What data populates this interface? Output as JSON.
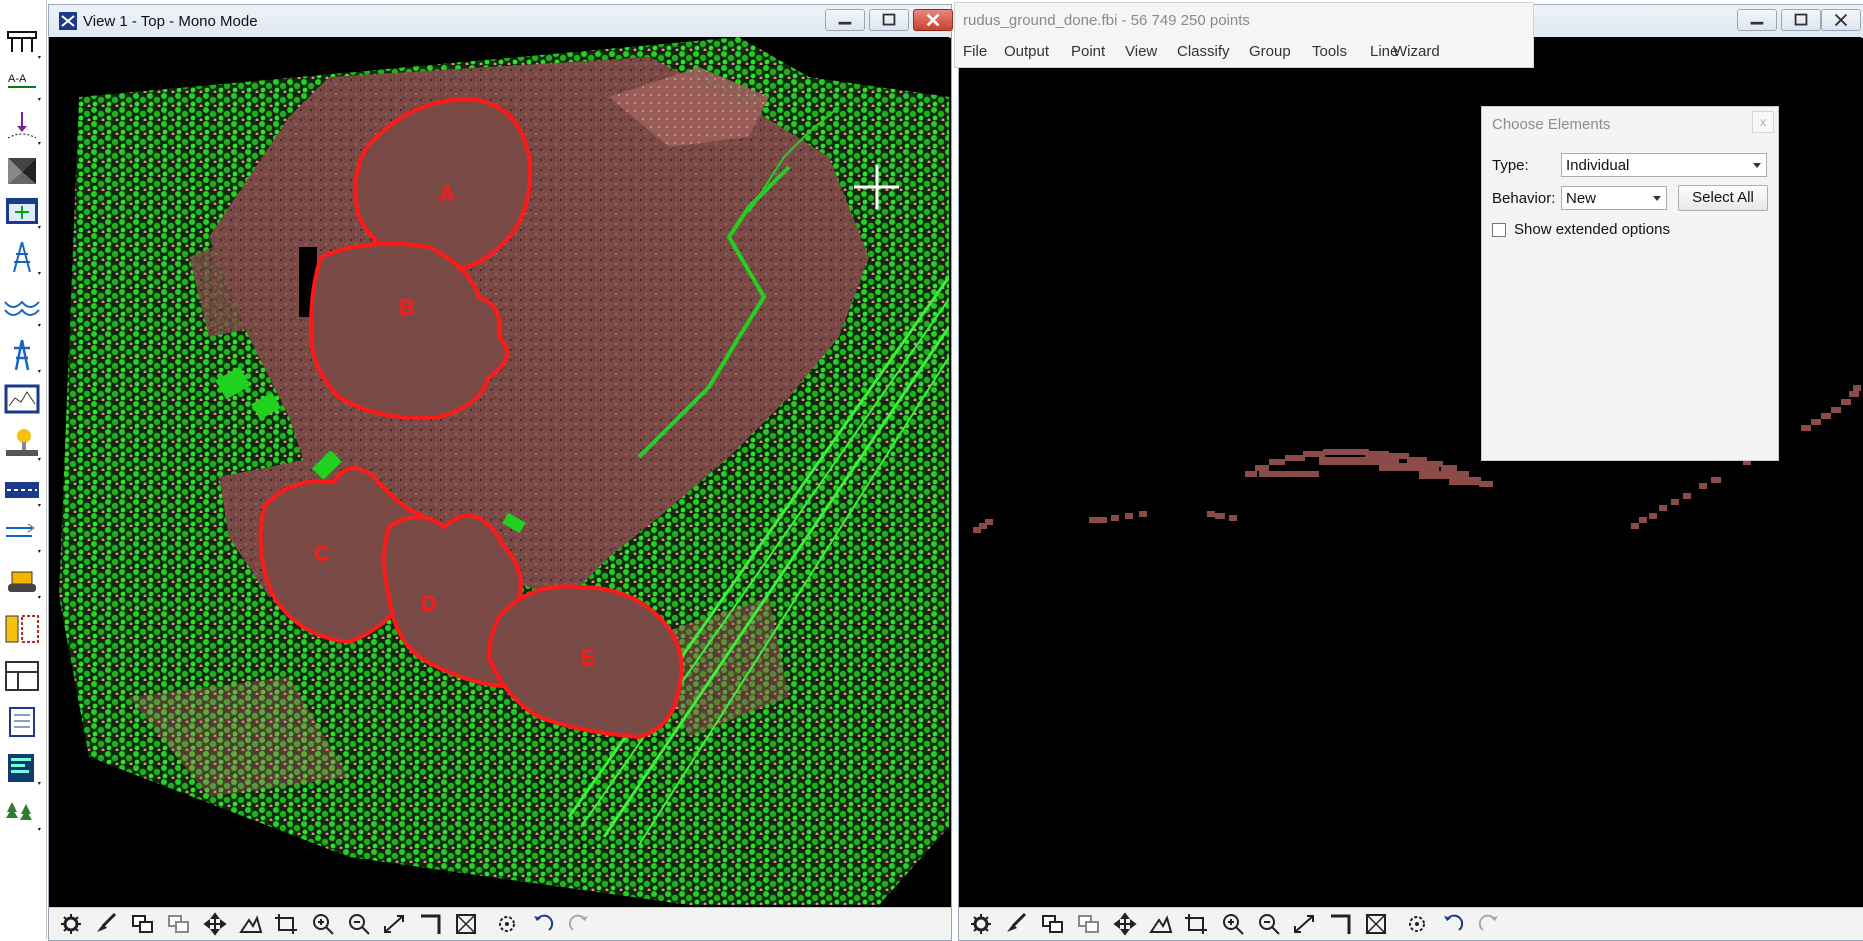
{
  "toolbar": {
    "tools": [
      "section-icon",
      "cut-section-icon",
      "point-drop-icon",
      "triangle-icon",
      "view-icon",
      "tower-icon",
      "wire-icon",
      "pylon-icon",
      "profile-icon",
      "lamp-icon",
      "road-icon",
      "cable-icon",
      "bulldozer-icon",
      "frame-icon",
      "grid-icon",
      "report-icon",
      "graph-icon",
      "trees-icon"
    ],
    "section_label": "A-A"
  },
  "left_window": {
    "title": "View 1 - Top - Mono Mode",
    "region_labels": [
      "A",
      "B",
      "C",
      "D",
      "E"
    ],
    "colors": {
      "ground": "#7a4a47",
      "vegetation": "#21d11f",
      "unclassified": "#f08c8c",
      "boundary": "#ff1a1a"
    }
  },
  "right_window": {
    "file_title": "rudus_ground_done.fbi - 56 749 250 points",
    "menu": [
      "File",
      "Output",
      "Point",
      "View",
      "Classify",
      "Group",
      "Tools",
      "Line",
      "Wizard"
    ]
  },
  "dialog": {
    "title": "Choose Elements",
    "close": "x",
    "type_label": "Type:",
    "type_value": "Individual",
    "behavior_label": "Behavior:",
    "behavior_value": "New",
    "select_all": "Select All",
    "show_extended": "Show extended options",
    "show_extended_checked": false
  },
  "view_toolbar": [
    "settings-icon",
    "brush-icon",
    "layers-icon",
    "layers-gray-icon",
    "pan-icon",
    "fit-icon",
    "crop-icon",
    "zoom-in-icon",
    "zoom-out-icon",
    "zoom-extent-icon",
    "frame-icon",
    "box-icon",
    "rotate-icon",
    "undo-icon",
    "redo-icon"
  ]
}
